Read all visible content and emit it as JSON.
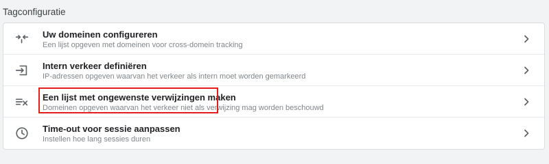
{
  "section": {
    "title": "Tagconfiguratie"
  },
  "rows": [
    {
      "icon": "merge-arrows-icon",
      "title": "Uw domeinen configureren",
      "description": "Een lijst opgeven met domeinen voor cross-domein tracking"
    },
    {
      "icon": "login-arrow-icon",
      "title": "Intern verkeer definiëren",
      "description": "IP-adressen opgeven waarvan het verkeer als intern moet worden gemarkeerd"
    },
    {
      "icon": "list-remove-icon",
      "title": "Een lijst met ongewenste verwijzingen maken",
      "description": "Domeinen opgeven waarvan het verkeer niet als verwijzing mag worden beschouwd",
      "highlighted": true
    },
    {
      "icon": "clock-icon",
      "title": "Time-out voor sessie aanpassen",
      "description": "Instellen hoe lang sessies duren"
    }
  ],
  "colors": {
    "background": "#f1f3f4",
    "card": "#ffffff",
    "title_text": "#202124",
    "description_text": "#80868b",
    "icon": "#5f6368",
    "highlight": "#e31c1c"
  }
}
